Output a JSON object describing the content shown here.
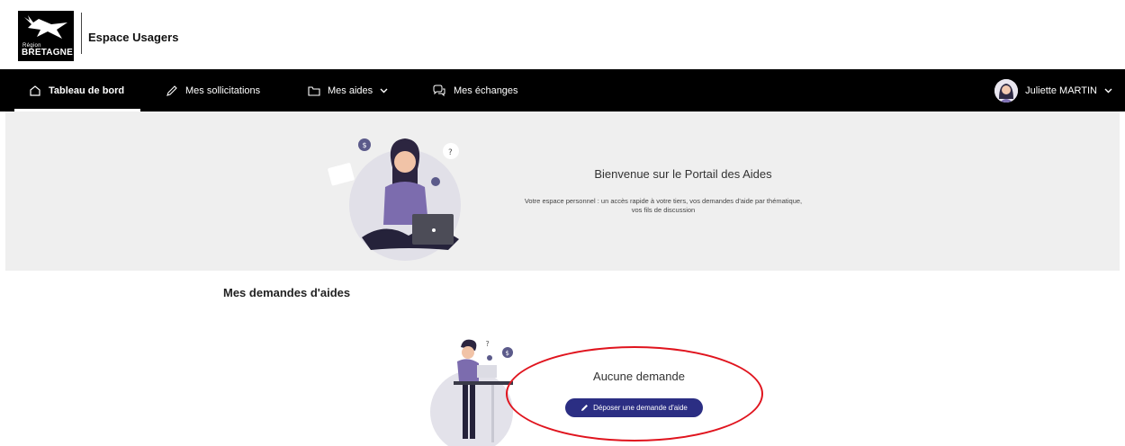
{
  "header": {
    "logo_region": "Région",
    "logo_name": "BRETAGNE",
    "app_title": "Espace Usagers"
  },
  "nav": {
    "items": [
      {
        "label": "Tableau de bord",
        "icon": "home-icon"
      },
      {
        "label": "Mes sollicitations",
        "icon": "pen-icon"
      },
      {
        "label": "Mes aides",
        "icon": "folder-icon"
      },
      {
        "label": "Mes échanges",
        "icon": "chat-icon"
      }
    ],
    "user_name": "Juliette MARTIN"
  },
  "hero": {
    "title": "Bienvenue sur le Portail des Aides",
    "text": "Votre espace personnel : un accès rapide à votre tiers, vos demandes d'aide par thématique, vos fils de discussion"
  },
  "requests": {
    "section_title": "Mes demandes d'aides",
    "empty_title": "Aucune demande",
    "cta_label": "Déposer une demande d'aide"
  },
  "colors": {
    "nav_bg": "#000000",
    "accent": "#2b2e83",
    "highlight": "#e0141e",
    "hero_bg": "#efefef"
  }
}
